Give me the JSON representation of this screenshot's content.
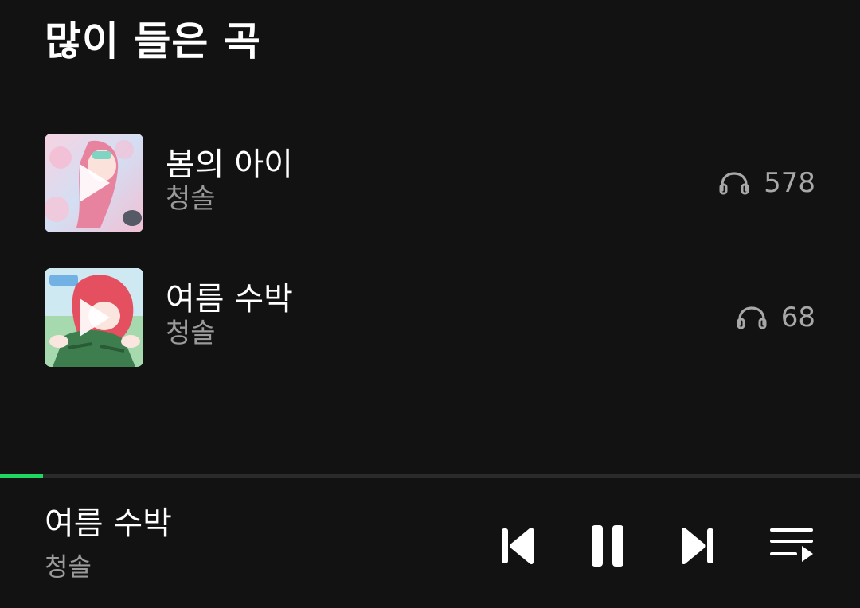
{
  "section": {
    "title": "많이 들은 곡"
  },
  "tracks": [
    {
      "title": "봄의 아이",
      "artist": "청솔",
      "plays": "578",
      "art_colors": [
        "#f5c6d8",
        "#c9d7f0",
        "#e88aa8"
      ],
      "icon": "headphones-icon"
    },
    {
      "title": "여름 수박",
      "artist": "청솔",
      "plays": "68",
      "art_colors": [
        "#9fd3a5",
        "#e85a6a",
        "#3f7a4c"
      ],
      "icon": "headphones-icon"
    }
  ],
  "player": {
    "title": "여름 수박",
    "artist": "청솔",
    "progress_fraction": 0.05,
    "controls": [
      "previous-icon",
      "pause-icon",
      "next-icon",
      "queue-icon"
    ]
  },
  "colors": {
    "background": "#121212",
    "accent": "#1ed760",
    "secondary_text": "#9a9a9a"
  }
}
